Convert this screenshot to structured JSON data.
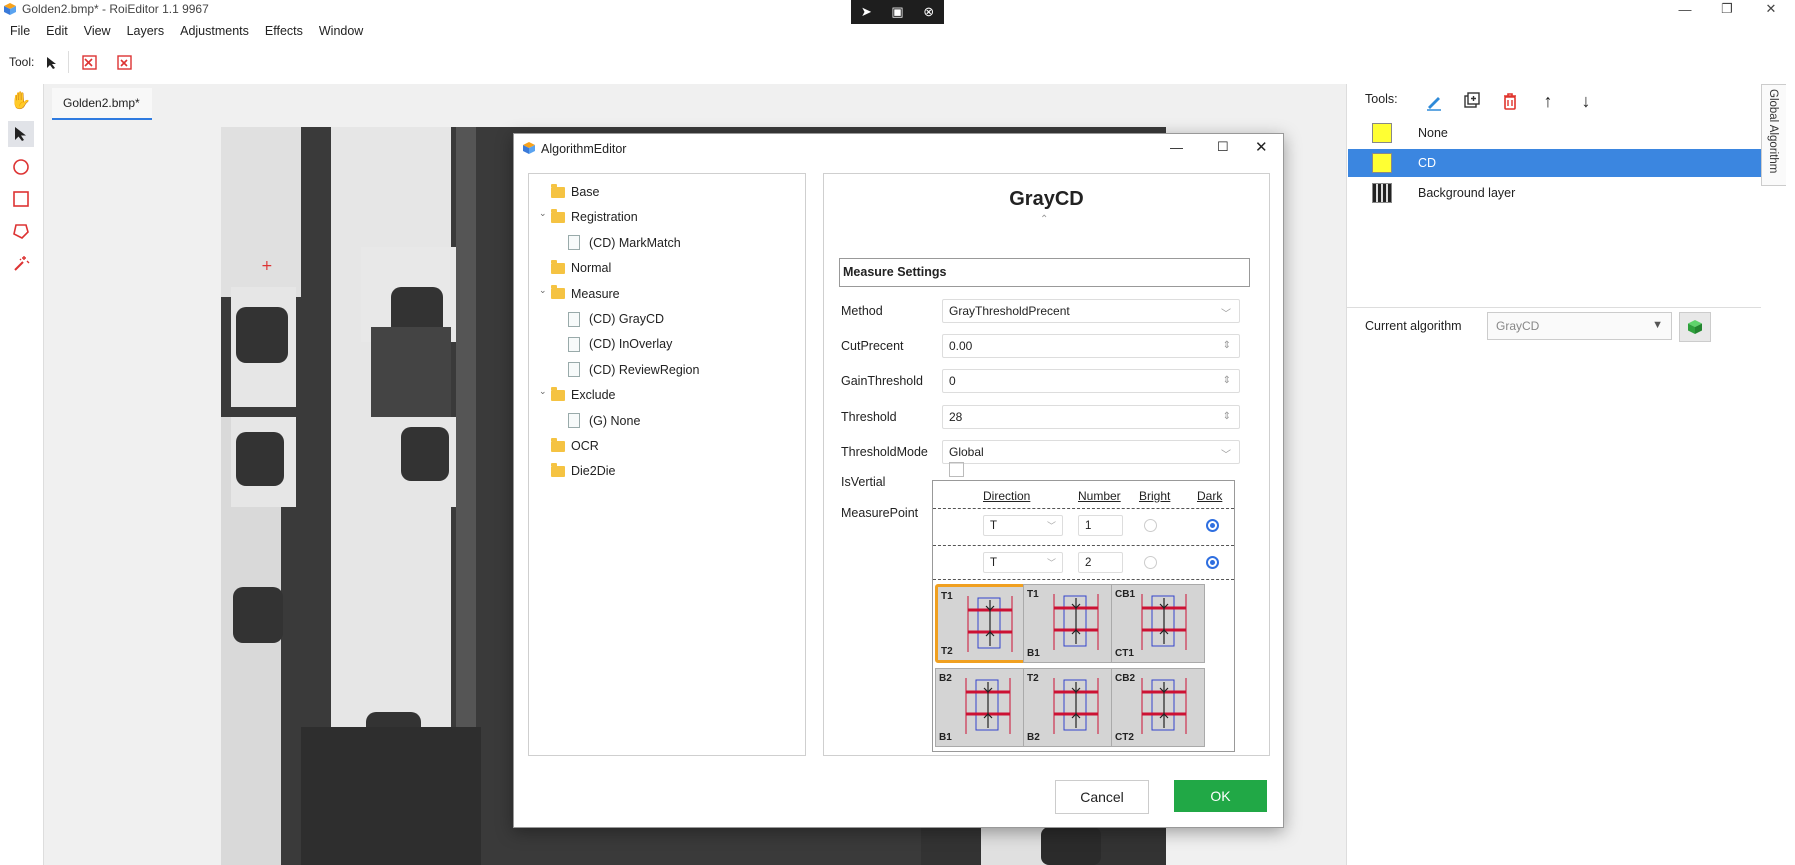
{
  "window": {
    "title": "Golden2.bmp* - RoiEditor 1.1 9967"
  },
  "menu": [
    "File",
    "Edit",
    "View",
    "Layers",
    "Adjustments",
    "Effects",
    "Window"
  ],
  "toolbar": {
    "label": "Tool:"
  },
  "document": {
    "tab": "Golden2.bmp*"
  },
  "dialog": {
    "title": "AlgorithmEditor",
    "tree": [
      {
        "label": "Base",
        "type": "folder",
        "level": 0,
        "expandable": false
      },
      {
        "label": "Registration",
        "type": "folder",
        "level": 0,
        "expandable": true
      },
      {
        "label": "(CD) MarkMatch",
        "type": "item",
        "level": 1
      },
      {
        "label": "Normal",
        "type": "folder",
        "level": 0,
        "expandable": false
      },
      {
        "label": "Measure",
        "type": "folder",
        "level": 0,
        "expandable": true
      },
      {
        "label": "(CD) GrayCD",
        "type": "item",
        "level": 1
      },
      {
        "label": "(CD) InOverlay",
        "type": "item",
        "level": 1
      },
      {
        "label": "(CD) ReviewRegion",
        "type": "item",
        "level": 1
      },
      {
        "label": "Exclude",
        "type": "folder",
        "level": 0,
        "expandable": true
      },
      {
        "label": "(G) None",
        "type": "item",
        "level": 1
      },
      {
        "label": "OCR",
        "type": "folder",
        "level": 0,
        "expandable": false
      },
      {
        "label": "Die2Die",
        "type": "folder",
        "level": 0,
        "expandable": false
      }
    ],
    "algorithm_name": "GrayCD",
    "section": "Measure Settings",
    "props": {
      "method_label": "Method",
      "method_value": "GrayThresholdPrecent",
      "cut_label": "CutPrecent",
      "cut_value": "0.00",
      "gain_label": "GainThreshold",
      "gain_value": "0",
      "threshold_label": "Threshold",
      "threshold_value": "28",
      "mode_label": "ThresholdMode",
      "mode_value": "Global",
      "vertial_label": "IsVertial",
      "vertial_checked": false,
      "mp_label": "MeasurePoint"
    },
    "measure_point": {
      "headers": {
        "direction": "Direction",
        "number": "Number",
        "bright": "Bright",
        "dark": "Dark"
      },
      "rows": [
        {
          "direction": "T",
          "number": "1",
          "selected": "Dark"
        },
        {
          "direction": "T",
          "number": "2",
          "selected": "Dark"
        }
      ],
      "tiles": [
        {
          "top": "T1",
          "bottom": "T2",
          "selected": true
        },
        {
          "top": "T1",
          "bottom": "B1",
          "selected": false
        },
        {
          "top": "CB1",
          "bottom": "CT1",
          "selected": false
        },
        {
          "top": "B2",
          "bottom": "B1",
          "selected": false
        },
        {
          "top": "T2",
          "bottom": "B2",
          "selected": false
        },
        {
          "top": "CB2",
          "bottom": "CT2",
          "selected": false
        }
      ]
    },
    "buttons": {
      "cancel": "Cancel",
      "ok": "OK"
    }
  },
  "right_panel": {
    "tools_label": "Tools:",
    "layers": [
      {
        "name": "None",
        "swatch": "#ffff33",
        "selected": false
      },
      {
        "name": "CD",
        "swatch": "#ffff33",
        "selected": true
      },
      {
        "name": "Background layer",
        "swatch": "thumbnail",
        "selected": false
      }
    ],
    "current_algorithm_label": "Current algorithm",
    "current_algorithm_value": "GrayCD",
    "global_tab": "Global Algorithm"
  },
  "colors": {
    "accent": "#3b86e0",
    "ok_green": "#21a846",
    "tile_highlight": "#f0a020",
    "delete_red": "#e0342c"
  }
}
